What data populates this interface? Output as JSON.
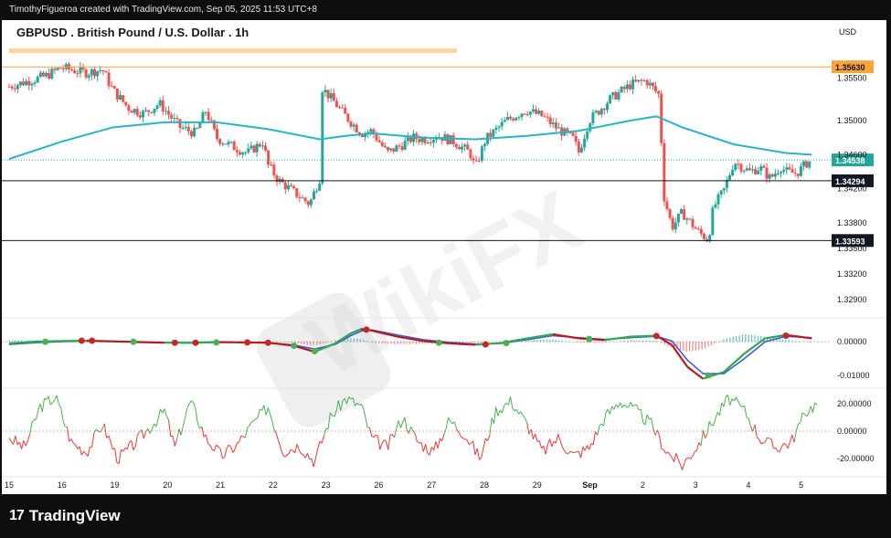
{
  "header": {
    "created_by": "TimothyFigueroa created with TradingView.com, Sep 05, 2025 11:53 UTC+8"
  },
  "chart": {
    "title": "GBPUSD . British Pound / U.S. Dollar . 1h",
    "currency": "USD"
  },
  "watermark": "WikiFX",
  "footer": {
    "logo_glyph": "17",
    "brand": "TradingView"
  },
  "colors": {
    "up_candle": "#26a69a",
    "down_candle": "#ef5350",
    "ma_line": "#26b5c6",
    "macd_line": "#3b5bdb",
    "signal_green": "#2fa84f",
    "signal_red": "#b71c1c",
    "oscillator_up": "#4caf50",
    "oscillator_down": "#e53935",
    "resistance_label": "#f7a43a",
    "level_label": "#131722",
    "price_label": "#26a69a"
  },
  "chart_data": [
    {
      "type": "candlestick",
      "title": "GBPUSD . British Pound / U.S. Dollar . 1h",
      "x_ticks": [
        "15",
        "16",
        "19",
        "20",
        "21",
        "22",
        "23",
        "26",
        "27",
        "28",
        "29",
        "Sep",
        "2",
        "3",
        "4",
        "5"
      ],
      "y_ticks": [
        1.329,
        1.332,
        1.335,
        1.338,
        1.342,
        1.346,
        1.35,
        1.355
      ],
      "ylim": [
        1.3275,
        1.3575
      ],
      "levels": [
        {
          "label": "1.35630",
          "value": 1.3563,
          "style": "orange"
        },
        {
          "label": "1.34294",
          "value": 1.34294,
          "style": "black"
        },
        {
          "label": "1.33593",
          "value": 1.33593,
          "style": "black"
        }
      ],
      "last_price": {
        "label": "1.34538",
        "value": 1.34538
      },
      "close_path": [
        [
          0,
          1.354
        ],
        [
          0.7,
          1.3552
        ],
        [
          1,
          1.3562
        ],
        [
          1.5,
          1.3556
        ],
        [
          1.8,
          1.356
        ],
        [
          2,
          1.3536
        ],
        [
          2.3,
          1.3515
        ],
        [
          2.6,
          1.3508
        ],
        [
          2.9,
          1.352
        ],
        [
          3,
          1.3513
        ],
        [
          3.3,
          1.3492
        ],
        [
          3.6,
          1.3485
        ],
        [
          3.8,
          1.3512
        ],
        [
          4,
          1.348
        ],
        [
          4.3,
          1.347
        ],
        [
          4.6,
          1.3462
        ],
        [
          4.9,
          1.3475
        ],
        [
          5,
          1.3448
        ],
        [
          5.2,
          1.343
        ],
        [
          5.5,
          1.3416
        ],
        [
          5.8,
          1.3402
        ],
        [
          6,
          1.3433
        ],
        [
          6.05,
          1.3538
        ],
        [
          6.3,
          1.352
        ],
        [
          6.5,
          1.3505
        ],
        [
          6.8,
          1.3485
        ],
        [
          7,
          1.3488
        ],
        [
          7.3,
          1.3462
        ],
        [
          7.6,
          1.3472
        ],
        [
          7.8,
          1.348
        ],
        [
          8,
          1.3478
        ],
        [
          8.3,
          1.3482
        ],
        [
          8.6,
          1.3475
        ],
        [
          8.9,
          1.3462
        ],
        [
          9,
          1.3444
        ],
        [
          9.2,
          1.3478
        ],
        [
          9.6,
          1.35
        ],
        [
          9.9,
          1.351
        ],
        [
          10,
          1.3512
        ],
        [
          10.3,
          1.3505
        ],
        [
          10.6,
          1.349
        ],
        [
          10.9,
          1.3478
        ],
        [
          11,
          1.3463
        ],
        [
          11.2,
          1.35
        ],
        [
          11.6,
          1.3525
        ],
        [
          12,
          1.3542
        ],
        [
          12.3,
          1.3547
        ],
        [
          12.55,
          1.353
        ],
        [
          12.65,
          1.341
        ],
        [
          12.8,
          1.3375
        ],
        [
          13,
          1.3392
        ],
        [
          13.3,
          1.337
        ],
        [
          13.5,
          1.336
        ],
        [
          13.6,
          1.3398
        ],
        [
          13.8,
          1.3418
        ],
        [
          14,
          1.3452
        ],
        [
          14.3,
          1.344
        ],
        [
          14.5,
          1.3445
        ],
        [
          14.7,
          1.3432
        ],
        [
          14.9,
          1.3446
        ],
        [
          15,
          1.344
        ],
        [
          15.2,
          1.3438
        ],
        [
          15.4,
          1.345
        ],
        [
          15.5,
          1.34538
        ]
      ],
      "moving_average": [
        [
          0,
          1.3455
        ],
        [
          1,
          1.3475
        ],
        [
          2,
          1.3492
        ],
        [
          3,
          1.3498
        ],
        [
          4,
          1.3498
        ],
        [
          5,
          1.349
        ],
        [
          6,
          1.3478
        ],
        [
          6.5,
          1.3482
        ],
        [
          7,
          1.3485
        ],
        [
          8,
          1.348
        ],
        [
          9,
          1.3478
        ],
        [
          10,
          1.3482
        ],
        [
          11,
          1.3488
        ],
        [
          12,
          1.35
        ],
        [
          12.5,
          1.3505
        ],
        [
          13,
          1.3492
        ],
        [
          14,
          1.3472
        ],
        [
          15,
          1.3462
        ],
        [
          15.5,
          1.346
        ]
      ]
    },
    {
      "type": "line",
      "title": "",
      "y_ticks": [
        0.0,
        -0.01
      ],
      "ylim": [
        -0.013,
        0.006
      ],
      "series": [
        {
          "values": [
            [
              0,
              -0.0005
            ],
            [
              0.5,
              0.0
            ],
            [
              1,
              0.0002
            ],
            [
              1.5,
              0.0003
            ],
            [
              2,
              0.0001
            ],
            [
              2.5,
              -0.0001
            ],
            [
              3,
              -0.0003
            ],
            [
              3.5,
              -0.0003
            ],
            [
              4,
              -0.0001
            ],
            [
              4.5,
              -0.0002
            ],
            [
              5,
              -0.0003
            ],
            [
              5.5,
              -0.0012
            ],
            [
              5.9,
              -0.003
            ],
            [
              6.3,
              -0.0005
            ],
            [
              6.6,
              0.0025
            ],
            [
              6.8,
              0.0038
            ],
            [
              7,
              0.0033
            ],
            [
              7.5,
              0.0015
            ],
            [
              8,
              0.0002
            ],
            [
              8.5,
              -0.0005
            ],
            [
              9,
              -0.0009
            ],
            [
              9.5,
              -0.0004
            ],
            [
              10,
              0.001
            ],
            [
              10.5,
              0.0022
            ],
            [
              11,
              0.001
            ],
            [
              11.5,
              0.0005
            ],
            [
              12,
              0.0015
            ],
            [
              12.5,
              0.0018
            ],
            [
              12.8,
              -0.001
            ],
            [
              13.1,
              -0.0075
            ],
            [
              13.4,
              -0.011
            ],
            [
              13.8,
              -0.009
            ],
            [
              14.2,
              -0.0035
            ],
            [
              14.6,
              0.001
            ],
            [
              15,
              0.002
            ],
            [
              15.5,
              0.001
            ]
          ]
        },
        {
          "values": [
            [
              0,
              -0.0008
            ],
            [
              0.5,
              -0.0003
            ],
            [
              1,
              0.0
            ],
            [
              1.5,
              0.0002
            ],
            [
              2,
              0.0001
            ],
            [
              2.5,
              -0.0001
            ],
            [
              3,
              -0.0003
            ],
            [
              3.5,
              -0.0004
            ],
            [
              4,
              -0.0002
            ],
            [
              4.5,
              -0.0002
            ],
            [
              5,
              -0.0003
            ],
            [
              5.5,
              -0.001
            ],
            [
              5.9,
              -0.0022
            ],
            [
              6.3,
              -0.0008
            ],
            [
              6.6,
              0.0018
            ],
            [
              6.8,
              0.0032
            ],
            [
              7,
              0.0035
            ],
            [
              7.5,
              0.002
            ],
            [
              8,
              0.0006
            ],
            [
              8.5,
              -0.0002
            ],
            [
              9,
              -0.0007
            ],
            [
              9.5,
              -0.0005
            ],
            [
              10,
              0.0006
            ],
            [
              10.5,
              0.0018
            ],
            [
              11,
              0.0012
            ],
            [
              11.5,
              0.0007
            ],
            [
              12,
              0.0012
            ],
            [
              12.5,
              0.0016
            ],
            [
              12.8,
              0.0002
            ],
            [
              13.1,
              -0.0055
            ],
            [
              13.4,
              -0.0095
            ],
            [
              13.8,
              -0.0095
            ],
            [
              14.2,
              -0.005
            ],
            [
              14.6,
              0.0
            ],
            [
              15,
              0.0016
            ],
            [
              15.5,
              0.0012
            ]
          ]
        }
      ],
      "signal_dots": [
        {
          "x": 0.7,
          "y": 0.0,
          "color": "green"
        },
        {
          "x": 1.4,
          "y": 0.0003,
          "color": "red"
        },
        {
          "x": 1.6,
          "y": 0.0003,
          "color": "red"
        },
        {
          "x": 2.4,
          "y": 0.0,
          "color": "green"
        },
        {
          "x": 3.2,
          "y": -0.0003,
          "color": "red"
        },
        {
          "x": 3.6,
          "y": -0.0003,
          "color": "red"
        },
        {
          "x": 4.0,
          "y": -0.0002,
          "color": "green"
        },
        {
          "x": 4.6,
          "y": -0.0002,
          "color": "red"
        },
        {
          "x": 5.0,
          "y": -0.0003,
          "color": "red"
        },
        {
          "x": 5.5,
          "y": -0.0012,
          "color": "green"
        },
        {
          "x": 5.9,
          "y": -0.0028,
          "color": "green"
        },
        {
          "x": 6.9,
          "y": 0.0036,
          "color": "red"
        },
        {
          "x": 8.3,
          "y": -0.0003,
          "color": "green"
        },
        {
          "x": 9.2,
          "y": -0.0008,
          "color": "red"
        },
        {
          "x": 9.6,
          "y": -0.0004,
          "color": "green"
        },
        {
          "x": 11.2,
          "y": 0.0008,
          "color": "green"
        },
        {
          "x": 12.5,
          "y": 0.0017,
          "color": "red"
        },
        {
          "x": 13.5,
          "y": -0.01,
          "color": "green"
        },
        {
          "x": 15.0,
          "y": 0.0018,
          "color": "red"
        }
      ]
    },
    {
      "type": "line",
      "title": "",
      "y_ticks": [
        20.0,
        0.0,
        -20.0
      ],
      "ylim": [
        -30,
        30
      ],
      "series": [
        {
          "values": [
            [
              0,
              -5
            ],
            [
              0.3,
              -12
            ],
            [
              0.6,
              18
            ],
            [
              0.9,
              25
            ],
            [
              1.2,
              -8
            ],
            [
              1.5,
              -15
            ],
            [
              1.8,
              5
            ],
            [
              2.1,
              -20
            ],
            [
              2.4,
              -10
            ],
            [
              2.7,
              2
            ],
            [
              3.0,
              15
            ],
            [
              3.2,
              -12
            ],
            [
              3.5,
              22
            ],
            [
              3.8,
              -5
            ],
            [
              4.1,
              -18
            ],
            [
              4.4,
              -10
            ],
            [
              4.7,
              5
            ],
            [
              5.0,
              18
            ],
            [
              5.3,
              -15
            ],
            [
              5.6,
              -10
            ],
            [
              5.9,
              -22
            ],
            [
              6.2,
              10
            ],
            [
              6.5,
              24
            ],
            [
              6.8,
              18
            ],
            [
              7.0,
              -5
            ],
            [
              7.3,
              -12
            ],
            [
              7.6,
              10
            ],
            [
              7.9,
              -8
            ],
            [
              8.2,
              -15
            ],
            [
              8.5,
              8
            ],
            [
              8.8,
              -2
            ],
            [
              9.1,
              -20
            ],
            [
              9.4,
              15
            ],
            [
              9.7,
              22
            ],
            [
              10.0,
              5
            ],
            [
              10.3,
              -15
            ],
            [
              10.6,
              -5
            ],
            [
              10.9,
              -18
            ],
            [
              11.2,
              -12
            ],
            [
              11.5,
              10
            ],
            [
              11.8,
              22
            ],
            [
              12.1,
              15
            ],
            [
              12.4,
              5
            ],
            [
              12.7,
              -15
            ],
            [
              13.0,
              -25
            ],
            [
              13.3,
              -10
            ],
            [
              13.6,
              8
            ],
            [
              13.9,
              24
            ],
            [
              14.2,
              15
            ],
            [
              14.5,
              -5
            ],
            [
              14.8,
              -12
            ],
            [
              15.1,
              -8
            ],
            [
              15.4,
              15
            ],
            [
              15.6,
              20
            ]
          ]
        }
      ]
    }
  ]
}
